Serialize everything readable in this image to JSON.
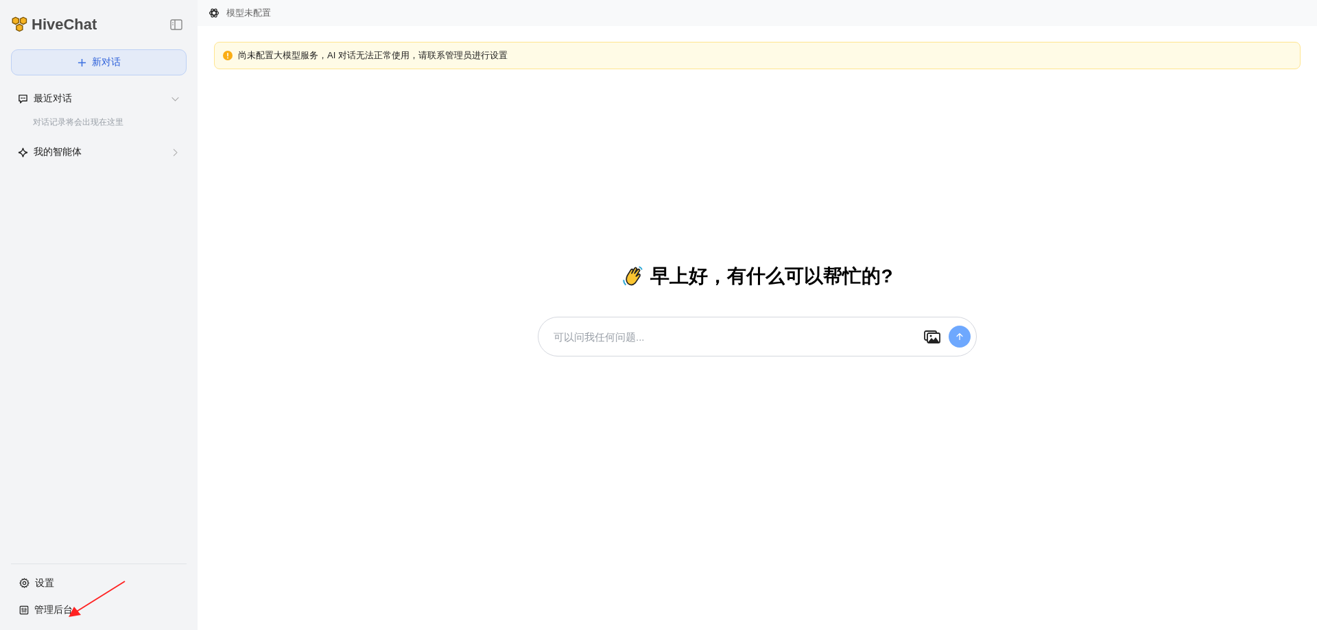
{
  "sidebar": {
    "logo": "HiveChat",
    "new_chat": "新对话",
    "sections": [
      {
        "kind": "expandable",
        "label": "最近对话",
        "expanded": true,
        "hint": "对话记录将会出现在这里"
      },
      {
        "kind": "link",
        "label": "我的智能体",
        "expanded": false
      }
    ],
    "footer": [
      {
        "kind": "settings",
        "label": "设置"
      },
      {
        "kind": "admin",
        "label": "管理后台"
      }
    ]
  },
  "top_bar": {
    "model": "模型未配置"
  },
  "alert": {
    "text": "尚未配置大模型服务，AI 对话无法正常使用，请联系管理员进行设置"
  },
  "greeting": "早上好，有什么可以帮忙的?",
  "composer": {
    "placeholder": "可以问我任何问题..."
  },
  "annotation": {
    "kind": "arrow"
  }
}
